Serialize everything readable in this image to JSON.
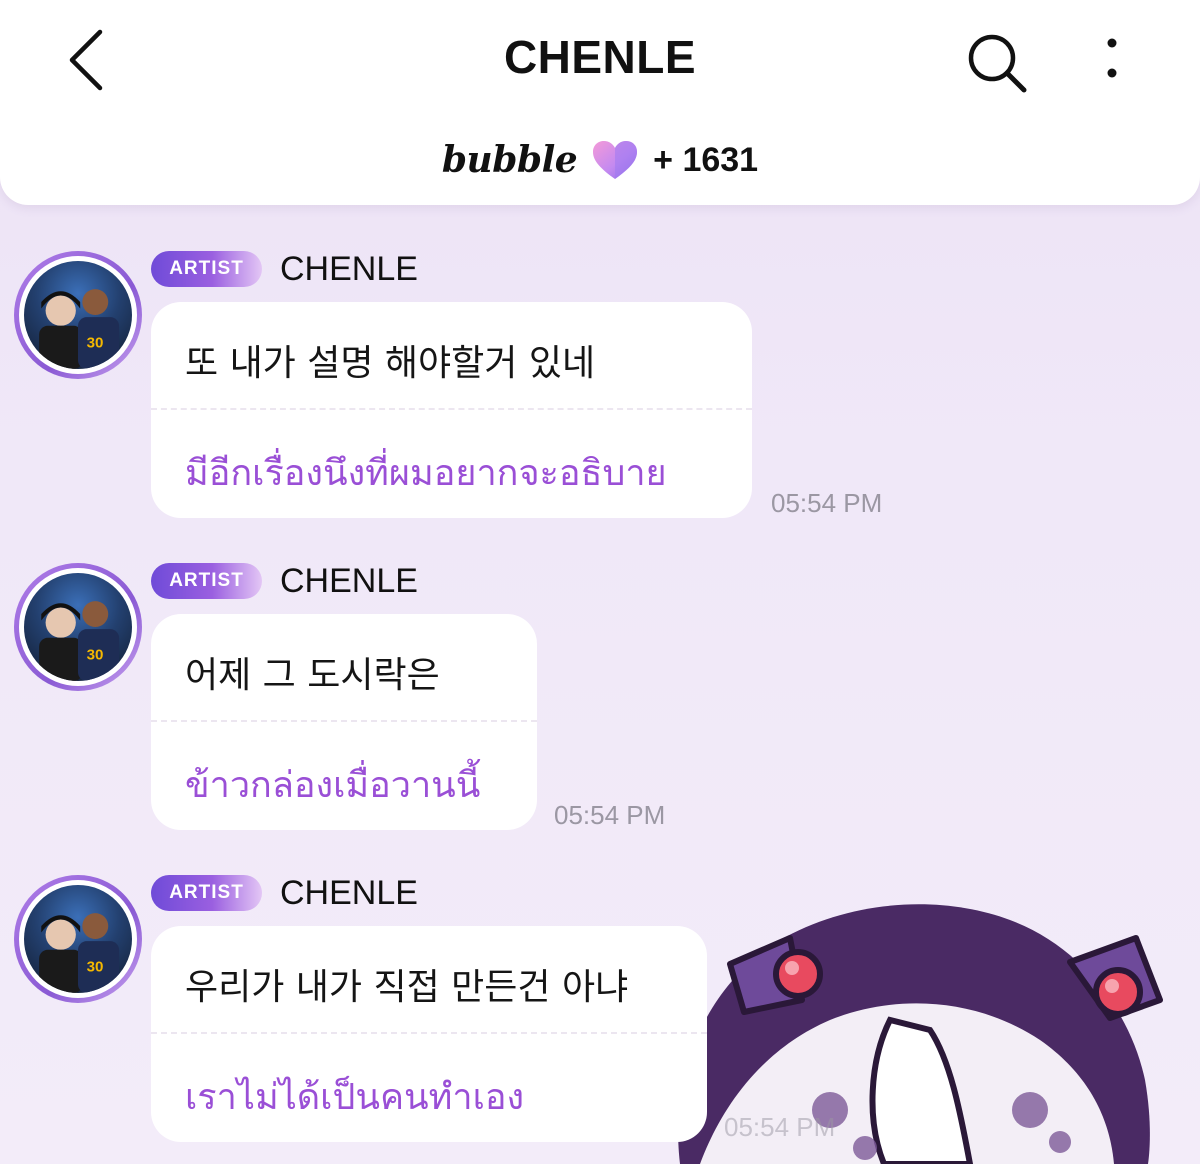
{
  "header": {
    "title": "CHENLE",
    "back_icon": "chevron-left-icon",
    "search_icon": "search-icon",
    "more_icon": "more-vertical-icon",
    "brand": "bubble",
    "heart_icon": "bubble-heart-icon",
    "count": "+ 1631"
  },
  "colors": {
    "accent": "#9a4fd6",
    "badge_start": "#6f4bd8",
    "background": "#ece2f5"
  },
  "messages": [
    {
      "badge": "ARTIST",
      "name": "CHENLE",
      "korean": "또 내가 설명 해야할거 있네",
      "thai": "มีอีกเรื่องนึงที่ผมอยากจะอธิบาย",
      "time": "05:54 PM"
    },
    {
      "badge": "ARTIST",
      "name": "CHENLE",
      "korean": "어제 그 도시락은",
      "thai": "ข้าวกล่องเมื่อวานนี้",
      "time": "05:54 PM"
    },
    {
      "badge": "ARTIST",
      "name": "CHENLE",
      "korean": "우리가 내가 직접 만든건 아냐",
      "thai": "เราไม่ได้เป็นคนทำเอง",
      "time": "05:54 PM"
    }
  ]
}
